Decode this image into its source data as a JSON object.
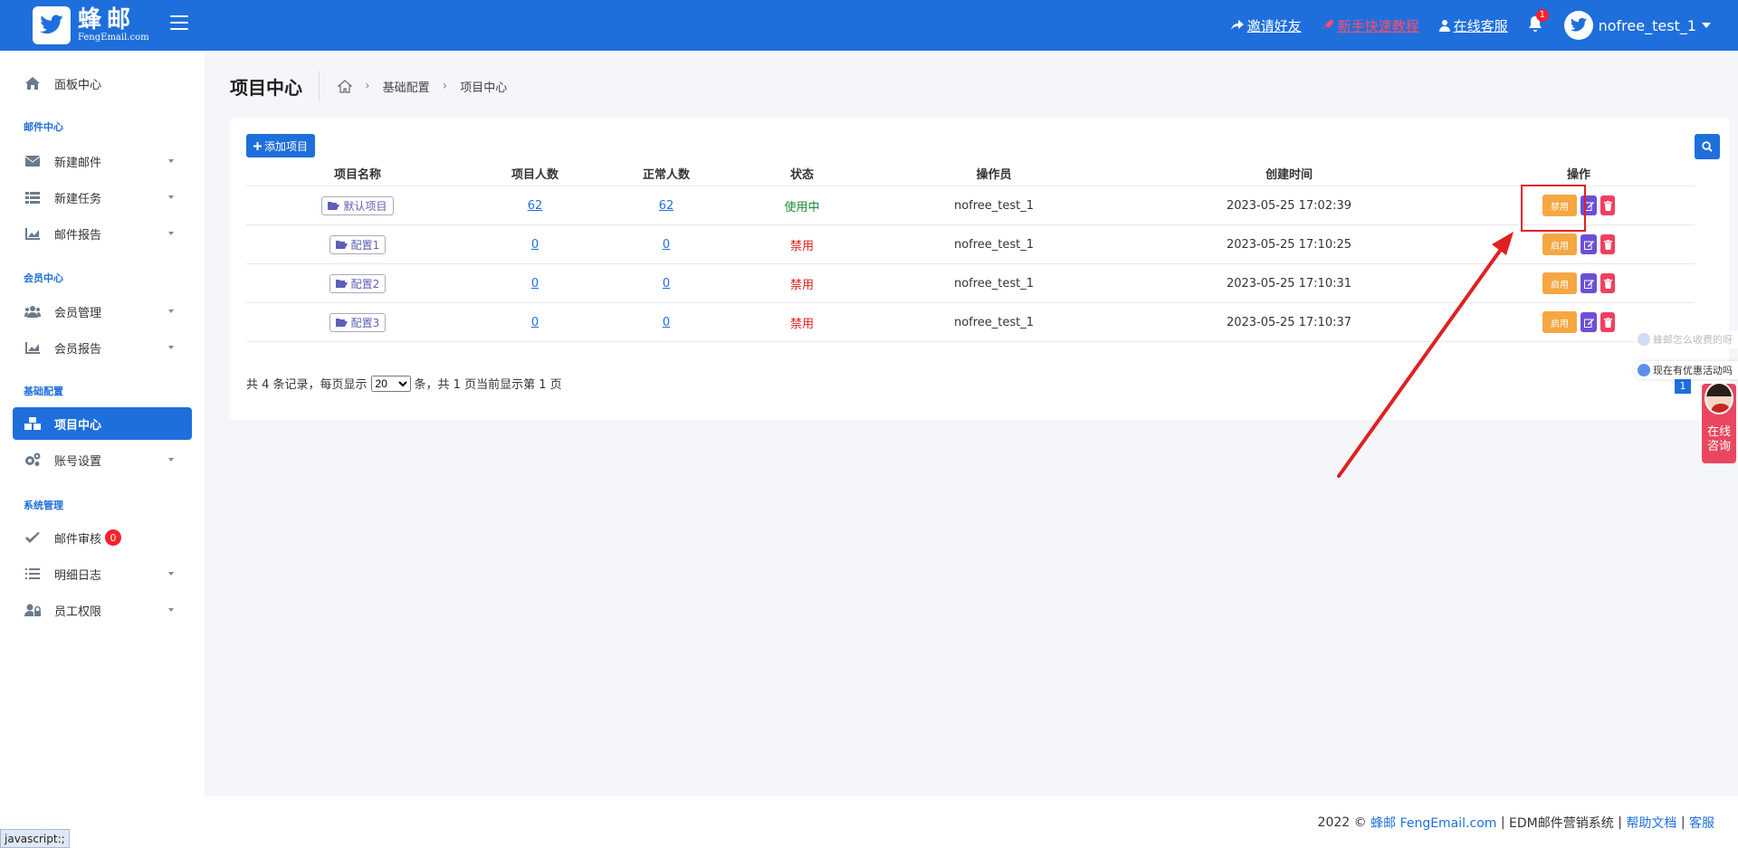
{
  "header": {
    "brand_cn": "蜂邮",
    "brand_en": "FengEmail.com",
    "links": [
      {
        "label": "邀请好友",
        "icon": "share-icon"
      },
      {
        "label": "新手快速教程",
        "icon": "rocket-icon"
      },
      {
        "label": "在线客服",
        "icon": "user-icon"
      }
    ],
    "notification_count": "1",
    "username": "nofree_test_1"
  },
  "sidebar": {
    "dashboard": "面板中心",
    "sections": [
      "邮件中心",
      "会员中心",
      "基础配置",
      "系统管理"
    ],
    "items": [
      {
        "label": "新建邮件",
        "icon": "envelope-icon"
      },
      {
        "label": "新建任务",
        "icon": "list-icon"
      },
      {
        "label": "邮件报告",
        "icon": "chart-icon"
      },
      {
        "label": "会员管理",
        "icon": "users-icon"
      },
      {
        "label": "会员报告",
        "icon": "chart-icon"
      },
      {
        "label": "项目中心",
        "icon": "cubes-icon"
      },
      {
        "label": "账号设置",
        "icon": "gears-icon"
      },
      {
        "label": "邮件审核",
        "icon": "check-icon"
      },
      {
        "label": "明细日志",
        "icon": "list-icon"
      },
      {
        "label": "员工权限",
        "icon": "user-lock-icon"
      }
    ],
    "review_badge": "0"
  },
  "page": {
    "title": "项目中心",
    "breadcrumb": [
      "基础配置",
      "项目中心"
    ]
  },
  "toolbar": {
    "add_label": "添加项目"
  },
  "table": {
    "headers": [
      "项目名称",
      "项目人数",
      "正常人数",
      "状态",
      "操作员",
      "创建时间",
      "操作"
    ],
    "rows": [
      {
        "name": "默认项目",
        "members": "62",
        "normal": "62",
        "status": "使用中",
        "operator": "nofree_test_1",
        "created": "2023-05-25 17:02:39",
        "toggle": "禁用"
      },
      {
        "name": "配置1",
        "members": "0",
        "normal": "0",
        "status": "禁用",
        "operator": "nofree_test_1",
        "created": "2023-05-25 17:10:25",
        "toggle": "启用"
      },
      {
        "name": "配置2",
        "members": "0",
        "normal": "0",
        "status": "禁用",
        "operator": "nofree_test_1",
        "created": "2023-05-25 17:10:31",
        "toggle": "启用"
      },
      {
        "name": "配置3",
        "members": "0",
        "normal": "0",
        "status": "禁用",
        "operator": "nofree_test_1",
        "created": "2023-05-25 17:10:37",
        "toggle": "启用"
      }
    ]
  },
  "pager": {
    "prefix": "共 4 条记录，每页显示",
    "page_size": "20",
    "page_size_options": [
      "20"
    ],
    "suffix": "条，共 1 页当前显示第 1 页",
    "current_page": "1"
  },
  "floating": {
    "hint1": "蜂邮怎么收费的呀",
    "hint2": "现在有优惠活动吗",
    "consult": "在线咨询"
  },
  "footer": {
    "copy": "2022 ©",
    "brand_link": "蜂邮 FengEmail.com",
    "sep1": "|",
    "system": "EDM邮件营销系统",
    "sep2": "|",
    "help": "帮助文档",
    "sep3": "|",
    "service": "客服"
  },
  "status_bar": "javascript:;",
  "colors": {
    "primary": "#1e6fdc",
    "active_status": "#1a8a2e",
    "disabled_status": "#e02020",
    "toggle_button": "#f5a742",
    "edit_button": "#6c4fd6",
    "delete_button": "#f04060",
    "annotation": "#e02020"
  }
}
